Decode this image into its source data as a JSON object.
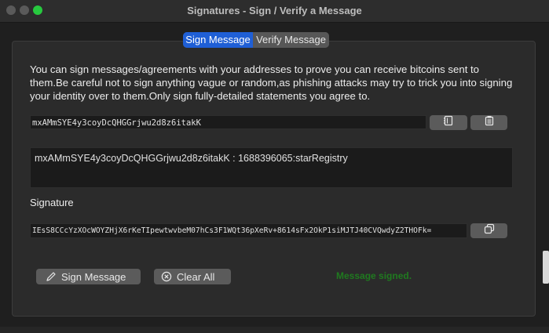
{
  "window": {
    "title": "Signatures - Sign / Verify a Message"
  },
  "tabs": [
    {
      "label": "Sign Message",
      "active": true
    },
    {
      "label": "Verify Message",
      "active": false
    }
  ],
  "description": "You can sign messages/agreements with your addresses to prove you can receive bitcoins sent to them.Be careful not to sign anything vague or random,as phishing attacks may try to trick you into signing your identity over to them.Only sign fully-detailed statements you agree to.",
  "address": {
    "value": "mxAMmSYE4y3coyDcQHGGrjwu2d8z6itakK"
  },
  "message": {
    "value": "mxAMmSYE4y3coyDcQHGGrjwu2d8z6itakK : 1688396065:starRegistry"
  },
  "signature": {
    "label": "Signature",
    "value": "IEsS8CCcYzXOcWOYZHjX6rKeTIpewtwvbeM07hCs3F1WQt36pXeRv+8614sFx2OkP1siMJTJ40CVQwdyZ2THOFk="
  },
  "buttons": {
    "sign": "Sign Message",
    "clear": "Clear All"
  },
  "status": {
    "text": "Message signed.",
    "color": "#1f7a1f"
  },
  "icons": {
    "address_book": "address-book-icon",
    "paste": "paste-icon",
    "copy": "copy-icon",
    "sign": "pen-icon",
    "clear": "clear-circle-icon"
  }
}
